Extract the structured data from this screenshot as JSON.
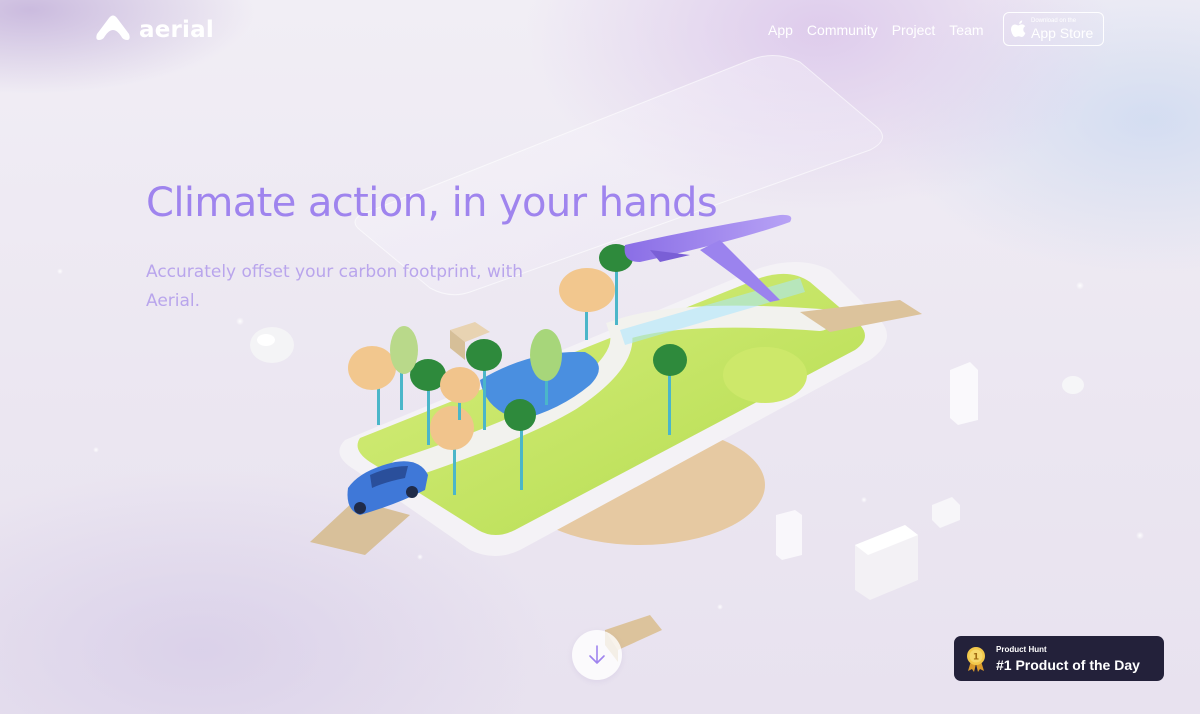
{
  "brand": {
    "name": "aerial"
  },
  "nav": {
    "items": [
      "App",
      "Community",
      "Project",
      "Team"
    ]
  },
  "app_store": {
    "small": "Download on the",
    "big": "App Store"
  },
  "hero": {
    "title": "Climate action, in your hands",
    "subtitle": "Accurately offset your carbon footprint, with Aerial."
  },
  "product_hunt": {
    "label": "Product Hunt",
    "title": "#1 Product of the Day",
    "rank": "1"
  },
  "colors": {
    "accent": "#9f84ee",
    "subtitle": "#b9a5ec",
    "badge_bg": "#23213a"
  },
  "icons": {
    "logo": "aerial-logo-icon",
    "apple": "apple-icon",
    "scroll": "arrow-down-icon",
    "medal": "medal-icon"
  }
}
